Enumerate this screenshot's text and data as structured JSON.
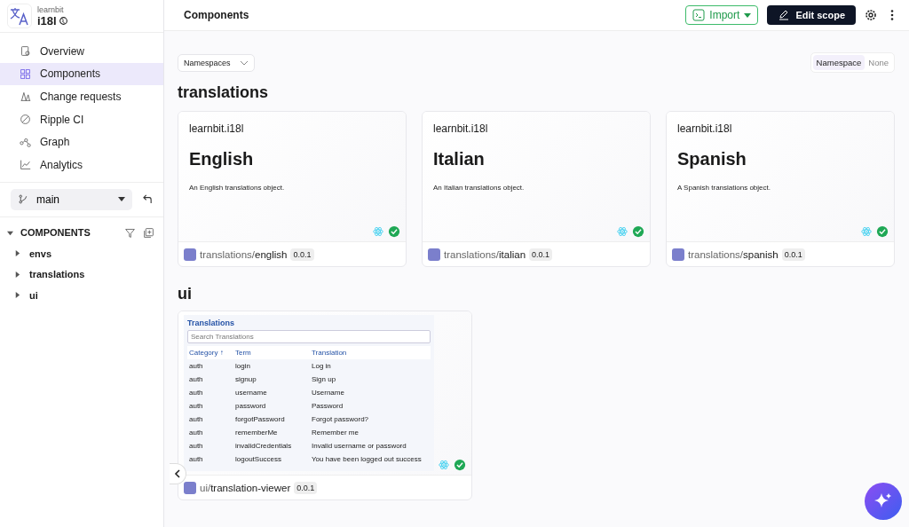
{
  "scope": {
    "org": "learnbit",
    "name": "i18l"
  },
  "header": {
    "title": "Components",
    "import_label": "Import",
    "edit_label": "Edit scope"
  },
  "nav": [
    {
      "label": "Overview",
      "selected": false
    },
    {
      "label": "Components",
      "selected": true
    },
    {
      "label": "Change requests",
      "selected": false
    },
    {
      "label": "Ripple CI",
      "selected": false
    },
    {
      "label": "Graph",
      "selected": false
    },
    {
      "label": "Analytics",
      "selected": false
    }
  ],
  "branch": {
    "value": "main"
  },
  "tree": {
    "label": "COMPONENTS",
    "expanded": true,
    "children": [
      {
        "label": "envs",
        "expanded": false
      },
      {
        "label": "translations",
        "expanded": false
      },
      {
        "label": "ui",
        "expanded": false
      }
    ]
  },
  "filter": {
    "label": "Namespaces"
  },
  "grouping": [
    {
      "label": "Namespace",
      "selected": true
    },
    {
      "label": "None",
      "selected": false
    }
  ],
  "sections": [
    {
      "title": "translations",
      "cards": [
        {
          "kind": "text",
          "scope": "learnbit.i18l",
          "title": "English",
          "description": "An English translations object.",
          "namespace": "translations/",
          "name": "english",
          "version": "0.0.1"
        },
        {
          "kind": "text",
          "scope": "learnbit.i18l",
          "title": "Italian",
          "description": "An Italian translations object.",
          "namespace": "translations/",
          "name": "italian",
          "version": "0.0.1"
        },
        {
          "kind": "text",
          "scope": "learnbit.i18l",
          "title": "Spanish",
          "description": "A Spanish translations object.",
          "namespace": "translations/",
          "name": "spanish",
          "version": "0.0.1"
        }
      ]
    },
    {
      "title": "ui",
      "cards": [
        {
          "kind": "preview",
          "preview": {
            "title": "Translations",
            "placeholder": "Search Translations",
            "columns": [
              "Category ↑",
              "Term",
              "Translation"
            ],
            "rows": [
              [
                "auth",
                "login",
                "Log in"
              ],
              [
                "auth",
                "signup",
                "Sign up"
              ],
              [
                "auth",
                "username",
                "Username"
              ],
              [
                "auth",
                "password",
                "Password"
              ],
              [
                "auth",
                "forgotPassword",
                "Forgot password?"
              ],
              [
                "auth",
                "rememberMe",
                "Remember me"
              ],
              [
                "auth",
                "invalidCredentials",
                "Invalid username or password"
              ],
              [
                "auth",
                "logoutSuccess",
                "You have been logged out success"
              ]
            ]
          },
          "namespace": "ui/",
          "name": "translation-viewer",
          "version": "0.0.1"
        }
      ]
    }
  ]
}
